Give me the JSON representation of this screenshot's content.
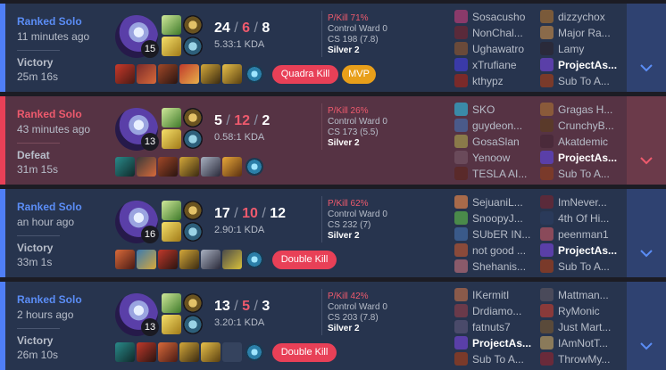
{
  "matches": [
    {
      "queue": "Ranked Solo",
      "ago": "11 minutes ago",
      "result": "Victory",
      "duration": "25m 16s",
      "level": "15",
      "kills": "24",
      "deaths": "6",
      "assists": "8",
      "kda": "5.33:1 KDA",
      "pkill": "P/Kill 71%",
      "ward": "Control Ward 0",
      "cs": "CS 198 (7.8)",
      "tier": "Silver 2",
      "badges": [
        "Quadra Kill",
        "MVP"
      ],
      "team1": [
        "Sosacusho",
        "NonChal...",
        "Ughawatro",
        "xTrufiane",
        "kthypz"
      ],
      "team2": [
        "dizzychox",
        "Major Ra...",
        "Lamy",
        "ProjectAs...",
        "Sub To A..."
      ]
    },
    {
      "queue": "Ranked Solo",
      "ago": "43 minutes ago",
      "result": "Defeat",
      "duration": "31m 15s",
      "level": "13",
      "kills": "5",
      "deaths": "12",
      "assists": "2",
      "kda": "0.58:1 KDA",
      "pkill": "P/Kill 26%",
      "ward": "Control Ward 0",
      "cs": "CS 173 (5.5)",
      "tier": "Silver 2",
      "badges": [],
      "team1": [
        "SKO",
        "guydeon...",
        "GosaSlan",
        "Yenoow",
        "TESLA AI..."
      ],
      "team2": [
        "Gragas H...",
        "CrunchyB...",
        "Akatdemic",
        "ProjectAs...",
        "Sub To A..."
      ]
    },
    {
      "queue": "Ranked Solo",
      "ago": "an hour ago",
      "result": "Victory",
      "duration": "33m 1s",
      "level": "16",
      "kills": "17",
      "deaths": "10",
      "assists": "12",
      "kda": "2.90:1 KDA",
      "pkill": "P/Kill 62%",
      "ward": "Control Ward 0",
      "cs": "CS 232 (7)",
      "tier": "Silver 2",
      "badges": [
        "Double Kill"
      ],
      "team1": [
        "SejuaniL...",
        "SnoopyJ...",
        "SUbER IN...",
        "not good ...",
        "Shehanis..."
      ],
      "team2": [
        "ImNever...",
        "4th Of Hi...",
        "peenman1",
        "ProjectAs...",
        "Sub To A..."
      ]
    },
    {
      "queue": "Ranked Solo",
      "ago": "2 hours ago",
      "result": "Victory",
      "duration": "26m 10s",
      "level": "13",
      "kills": "13",
      "deaths": "5",
      "assists": "3",
      "kda": "3.20:1 KDA",
      "pkill": "P/Kill 42%",
      "ward": "Control Ward 0",
      "cs": "CS 203 (7.8)",
      "tier": "Silver 2",
      "badges": [
        "Double Kill"
      ],
      "team1": [
        "IKermitI",
        "Drdiamo...",
        "fatnuts7",
        "ProjectAs...",
        "Sub To A..."
      ],
      "team2": [
        "Mattman...",
        "RyMonic",
        "Just Mart...",
        "IAmNotT...",
        "ThrowMy..."
      ]
    }
  ],
  "colors": {
    "win": "#27344e",
    "loss": "#563344",
    "win_accent": "#4f7ef6",
    "loss_accent": "#e84057",
    "death": "#ee5a6d"
  }
}
